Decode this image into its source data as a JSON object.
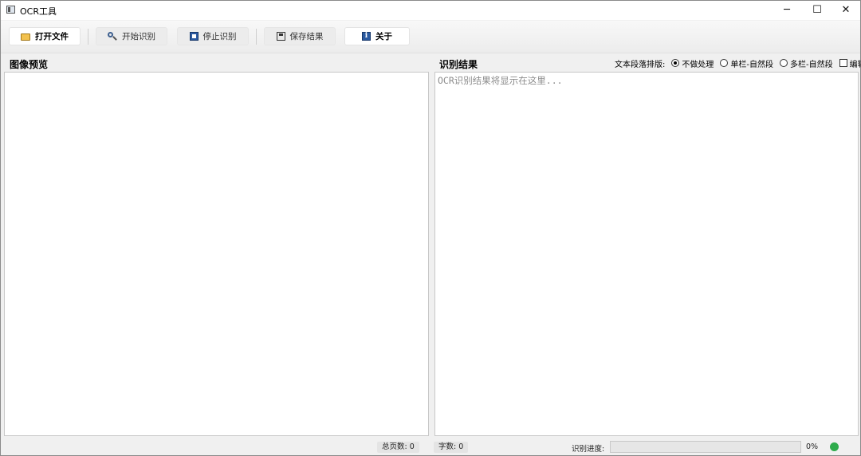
{
  "window": {
    "title": "OCR工具",
    "minimize": "─",
    "maximize": "☐",
    "close": "✕"
  },
  "toolbar": {
    "open_file": "打开文件",
    "start_recognition": "开始识别",
    "stop_recognition": "停止识别",
    "save_result": "保存结果",
    "about": "关于",
    "about_icon_glyph": "i"
  },
  "preview": {
    "title": "图像预览"
  },
  "result": {
    "title": "识别结果",
    "placeholder": "OCR识别结果将显示在这里..."
  },
  "layout_options": {
    "label": "文本段落排版:",
    "options": [
      "不做处理",
      "单栏-自然段",
      "多栏-自然段"
    ],
    "selected": "不做处理",
    "edit_label": "编辑",
    "edit_checked": false
  },
  "status": {
    "total_pages": "总页数: 0",
    "char_count": "字数: 0",
    "progress_label": "识别进度:",
    "progress_percent": "0%",
    "progress_value": 0,
    "indicator_color": "#2eab4b"
  }
}
